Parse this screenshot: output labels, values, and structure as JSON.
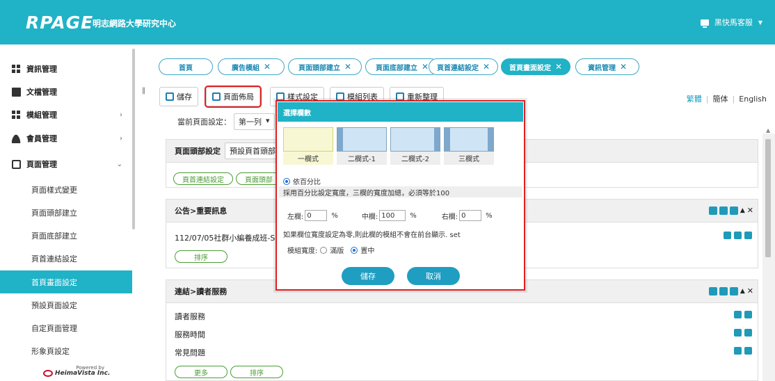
{
  "header": {
    "logo": "RPAGE",
    "org": "明志網路大學研究中心",
    "user_label": "黑快馬客服"
  },
  "sidebar": {
    "items": [
      {
        "label": "資訊管理"
      },
      {
        "label": "文檔管理"
      },
      {
        "label": "模組管理"
      },
      {
        "label": "會員管理"
      },
      {
        "label": "頁面管理"
      }
    ],
    "sub_items": [
      {
        "label": "頁面樣式變更"
      },
      {
        "label": "頁面頭部建立"
      },
      {
        "label": "頁面底部建立"
      },
      {
        "label": "頁首連結設定"
      },
      {
        "label": "首頁畫面設定"
      },
      {
        "label": "預設頁面設定"
      },
      {
        "label": "自定頁面管理"
      },
      {
        "label": "形象頁設定"
      }
    ],
    "powered_by": "Powered by",
    "vendor": "HeimaVista Inc."
  },
  "tabs": [
    {
      "label": "首頁"
    },
    {
      "label": "廣告模組"
    },
    {
      "label": "頁面頭部建立"
    },
    {
      "label": "頁面底部建立"
    },
    {
      "label": "頁首連結設定"
    },
    {
      "label": "首頁畫面設定"
    },
    {
      "label": "資訊管理"
    }
  ],
  "toolbar": {
    "save": "儲存",
    "page_layout": "頁面佈局",
    "style_setting": "樣式設定",
    "module_list": "模組列表",
    "refresh": "重新整理"
  },
  "langs": {
    "trad": "繁體",
    "simp": "簡体",
    "en": "English"
  },
  "current": {
    "label": "當前頁面設定：",
    "value": "第一列"
  },
  "panels": {
    "header_setting": {
      "label": "頁面頭部設定",
      "select": "預設頁首頭部",
      "pill1": "頁首連結設定",
      "pill2": "頁面頭部"
    },
    "notice": {
      "title": "公告>重要訊息",
      "item": "112/07/05社群小編養成班-SEO",
      "sort": "排序"
    },
    "links": {
      "title": "連結>讀者服務",
      "items": [
        "讀者服務",
        "服務時間",
        "常見問題"
      ],
      "more": "更多",
      "sort": "排序"
    }
  },
  "modal": {
    "title": "選擇欄數",
    "layouts": [
      "一欄式",
      "二欄式-1",
      "二欄式-2",
      "三欄式"
    ],
    "percent_label": "依百分比",
    "percent_note": "採用百分比設定寬度，三欄的寬度加總，必須等於100",
    "left_label": "左欄:",
    "left_value": "0",
    "mid_label": "中欄:",
    "mid_value": "100",
    "right_label": "右欄:",
    "right_value": "0",
    "pct": "%",
    "zero_note": "如果欄位寬度設定為零,則此欄的模組不會在前台顯示. set",
    "module_width_label": "模組寬度:",
    "full_label": "滿版",
    "center_label": "置中",
    "save": "儲存",
    "cancel": "取消"
  }
}
